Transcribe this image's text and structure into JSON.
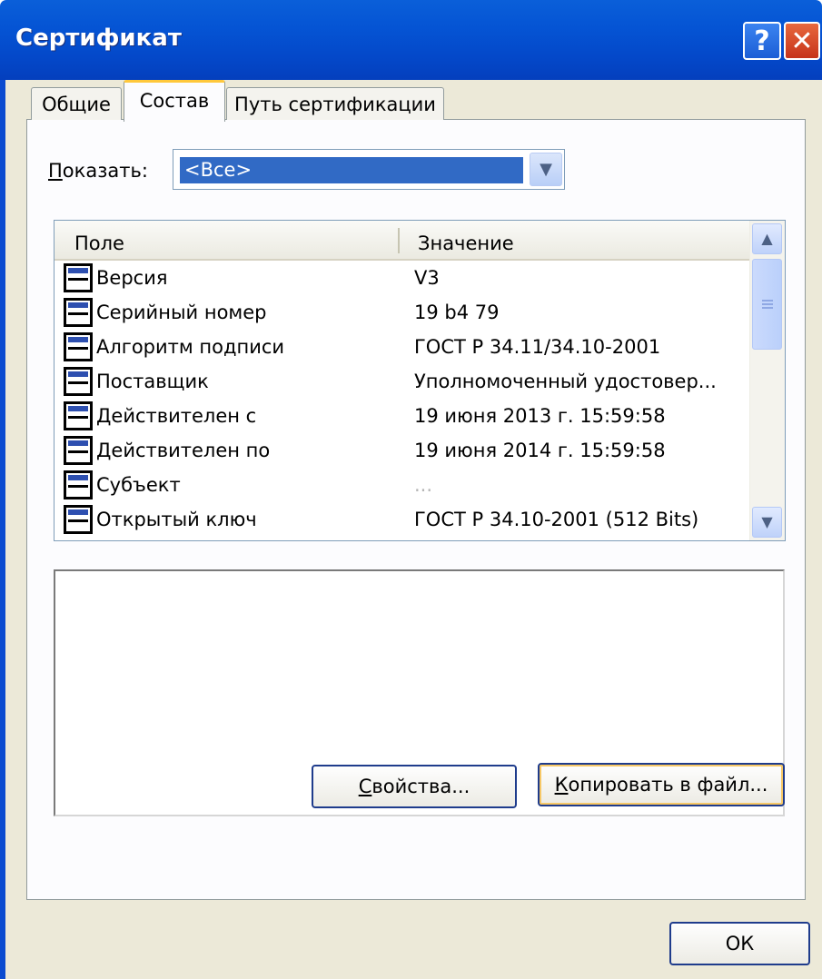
{
  "window": {
    "title": "Сертификат",
    "help_label": "?",
    "close_label": "✕"
  },
  "tabs": [
    {
      "label": "Общие",
      "selected": false
    },
    {
      "label": "Состав",
      "selected": true
    },
    {
      "label": "Путь сертификации",
      "selected": false
    }
  ],
  "show": {
    "label_accel": "П",
    "label_rest": "оказать:",
    "value": "<Все>"
  },
  "list": {
    "columns": [
      "Поле",
      "Значение"
    ],
    "rows": [
      {
        "field": "Версия",
        "value": "V3"
      },
      {
        "field": "Серийный номер",
        "value": "19 b4 79"
      },
      {
        "field": "Алгоритм подписи",
        "value": "ГОСТ Р 34.11/34.10-2001"
      },
      {
        "field": "Поставщик",
        "value": "Уполномоченный удостовер..."
      },
      {
        "field": "Действителен с",
        "value": "19 июня 2013 г. 15:59:58"
      },
      {
        "field": "Действителен по",
        "value": "19 июня 2014 г. 15:59:58"
      },
      {
        "field": "Субъект",
        "value": "..."
      },
      {
        "field": "Открытый ключ",
        "value": "ГОСТ Р 34.10-2001 (512 Bits)"
      }
    ]
  },
  "buttons": {
    "properties_accel": "С",
    "properties_rest": "войства...",
    "copy_accel": "К",
    "copy_rest": "опировать в файл...",
    "ok": "ОК"
  },
  "colors": {
    "titlebar": "#0554d4",
    "selection": "#316ac5",
    "face": "#ece9d8"
  },
  "icons": {
    "row_icon": "certificate-field-icon",
    "combo_arrow": "chevron-down-icon",
    "scroll_up": "chevron-up-icon",
    "scroll_down": "chevron-down-icon"
  }
}
